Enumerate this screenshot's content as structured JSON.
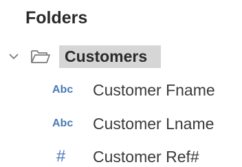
{
  "panel": {
    "title": "Folders"
  },
  "folder": {
    "name": "Customers",
    "expanded": true,
    "icon": "open-folder-icon"
  },
  "fields": [
    {
      "type_label": "Abc",
      "type_icon": "string-type-icon",
      "name": "Customer Fname"
    },
    {
      "type_label": "Abc",
      "type_icon": "string-type-icon",
      "name": "Customer Lname"
    },
    {
      "type_label": "#",
      "type_icon": "number-type-icon",
      "name": "Customer Ref#"
    }
  ],
  "colors": {
    "type_icon": "#4a78b8",
    "selection": "#d6d6d6"
  }
}
